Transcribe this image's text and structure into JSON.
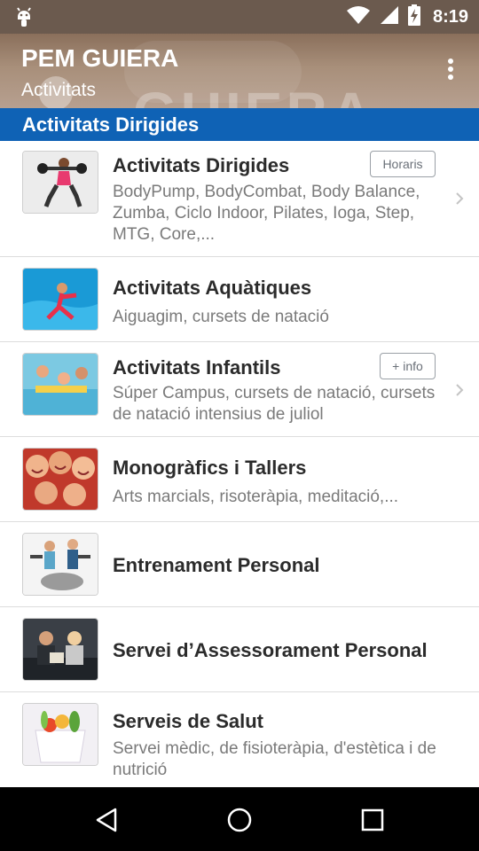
{
  "status_bar": {
    "time": "8:19",
    "icons": [
      "android-notification-icon",
      "wifi-icon",
      "signal-icon",
      "battery-charging-icon"
    ]
  },
  "header": {
    "title": "PEM GUIERA",
    "subtitle": "Activitats",
    "background_watermark": "GUIERA"
  },
  "section": {
    "title": "Activitats Dirigides"
  },
  "items": [
    {
      "title": "Activitats Dirigides",
      "description": "BodyPump, BodyCombat, Body Balance, Zumba, Ciclo Indoor, Pilates, Ioga, Step, MTG, Core,...",
      "button": "Horaris",
      "has_chevron": true
    },
    {
      "title": "Activitats Aquàtiques",
      "description": "Aiguagim, cursets de natació",
      "has_chevron": false
    },
    {
      "title": "Activitats Infantils",
      "description": "Súper Campus, cursets de natació, cursets de natació intensius de juliol",
      "button": "+ info",
      "has_chevron": true
    },
    {
      "title": "Monogràfics i Tallers",
      "description": "Arts marcials, risoteràpia, meditació,...",
      "has_chevron": false
    },
    {
      "title": "Entrenament Personal",
      "description": "",
      "has_chevron": false
    },
    {
      "title": "Servei d’Assessorament Personal",
      "description": "",
      "has_chevron": false
    },
    {
      "title": "Serveis de Salut",
      "description": "Servei mèdic, de fisioteràpia, d'estètica i de nutrició",
      "has_chevron": false
    }
  ],
  "nav_bar": {
    "buttons": [
      "back-icon",
      "home-icon",
      "recents-icon"
    ]
  },
  "colors": {
    "status_bar": "#6b5a4e",
    "section_header": "#0f62b5",
    "title_text": "#2b2b2b",
    "desc_text": "#7a7a7a",
    "nav_bar": "#000000"
  }
}
